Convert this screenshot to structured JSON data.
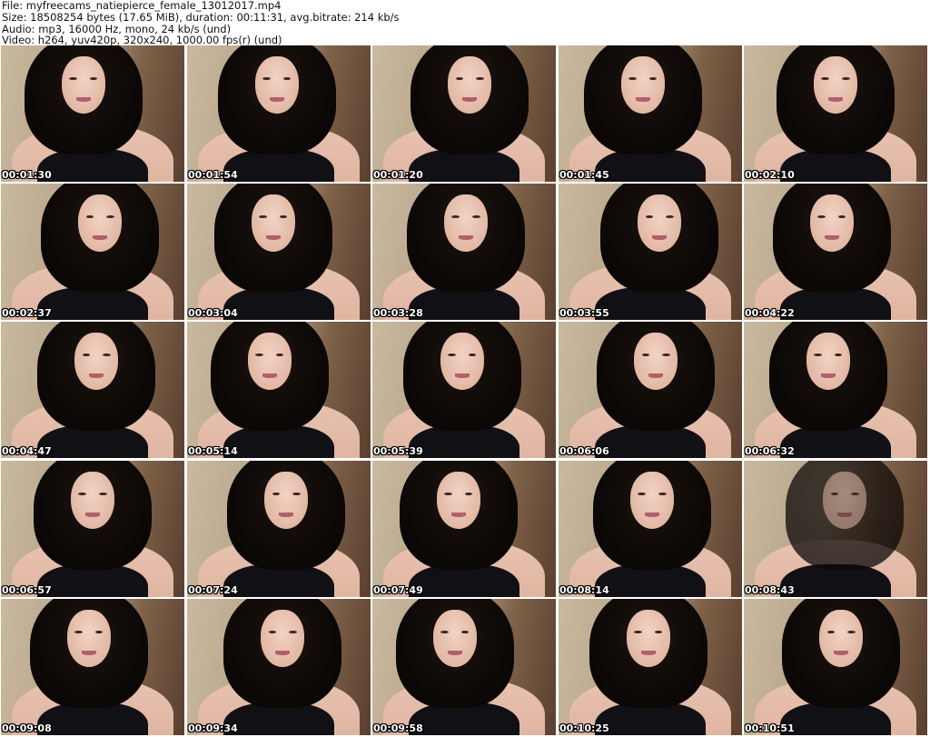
{
  "header": {
    "file_line": "File: myfreecams_natiepierce_female_13012017.mp4",
    "size_line": "Size: 18508254 bytes (17.65 MiB), duration: 00:11:31, avg.bitrate: 214 kb/s",
    "audio_line": "Audio: mp3, 16000 Hz, mono, 24 kb/s (und)",
    "video_line": "Video: h264, yuv420p, 320x240, 1000.00 fps(r) (und)"
  },
  "thumbnails": [
    {
      "timestamp": "00:01:30"
    },
    {
      "timestamp": "00:01:54"
    },
    {
      "timestamp": "00:01:20"
    },
    {
      "timestamp": "00:01:45"
    },
    {
      "timestamp": "00:02:10"
    },
    {
      "timestamp": "00:02:37"
    },
    {
      "timestamp": "00:03:04"
    },
    {
      "timestamp": "00:03:28"
    },
    {
      "timestamp": "00:03:55"
    },
    {
      "timestamp": "00:04:22"
    },
    {
      "timestamp": "00:04:47"
    },
    {
      "timestamp": "00:05:14"
    },
    {
      "timestamp": "00:05:39"
    },
    {
      "timestamp": "00:06:06"
    },
    {
      "timestamp": "00:06:32"
    },
    {
      "timestamp": "00:06:57"
    },
    {
      "timestamp": "00:07:24"
    },
    {
      "timestamp": "00:07:49"
    },
    {
      "timestamp": "00:08:14"
    },
    {
      "timestamp": "00:08:43"
    },
    {
      "timestamp": "00:09:08"
    },
    {
      "timestamp": "00:09:34"
    },
    {
      "timestamp": "00:09:58"
    },
    {
      "timestamp": "00:10:25"
    },
    {
      "timestamp": "00:10:51"
    }
  ]
}
